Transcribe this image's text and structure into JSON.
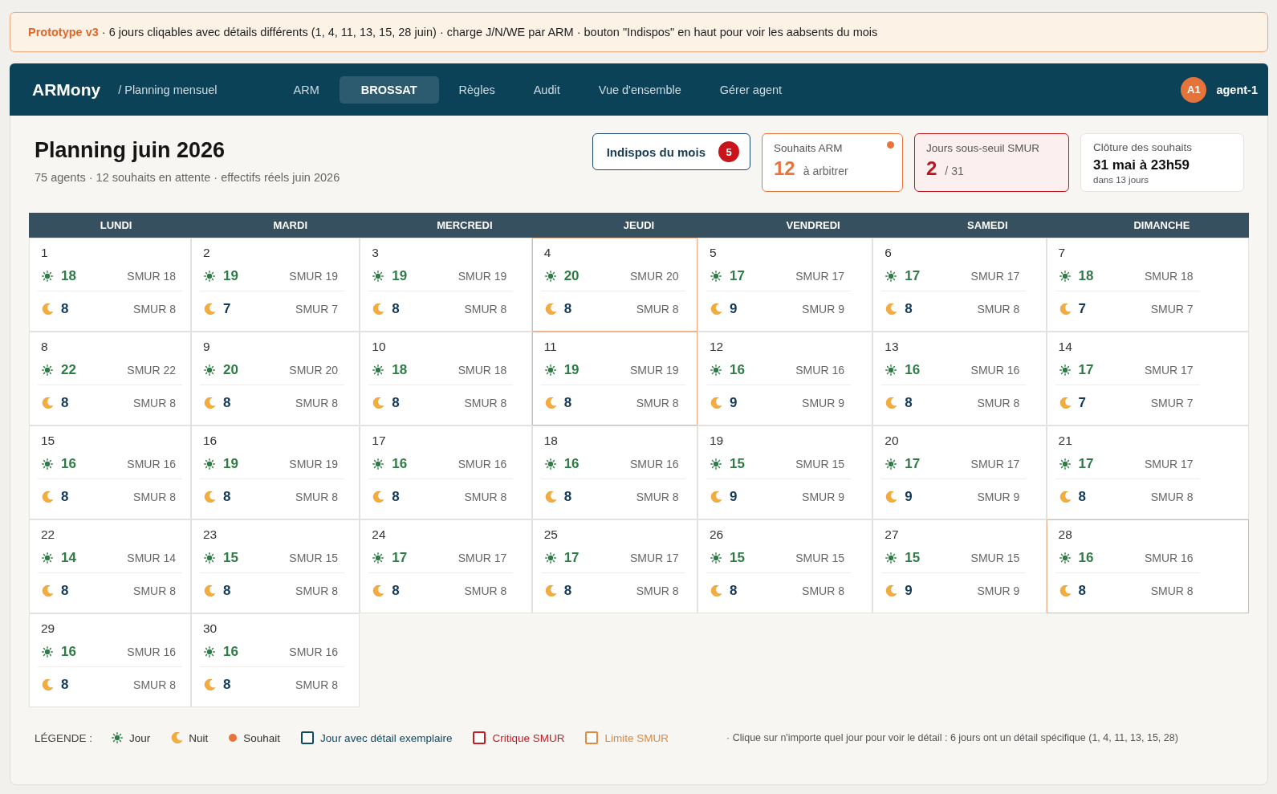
{
  "banner": {
    "text": "**Prototype v3** · 6 jours cliqables avec détails différents (1, 4, 11, 13, 15, 28 juin) · charge J/N/WE par ARM · bouton \"Indispos\" en haut pour voir les aabsents du mois"
  },
  "nav": {
    "brand": "ARMony",
    "breadcrumb": "/ Planning mensuel",
    "tabs": [
      {
        "label": "ARM",
        "selected": false
      },
      {
        "label": "BROSSAT",
        "selected": true
      },
      {
        "label": "Règles",
        "selected": false
      },
      {
        "label": "Audit",
        "selected": false
      },
      {
        "label": "Vue d'ensemble",
        "selected": false
      },
      {
        "label": "Gérer agent",
        "selected": false
      }
    ],
    "user": {
      "initials": "A1",
      "name": "agent-1"
    }
  },
  "header": {
    "title": "Planning juin 2026",
    "subtitle": "75 agents · 12 souhaits en attente · effectifs réels juin 2026"
  },
  "cards": [
    {
      "kind": "button",
      "label": "Indispos du mois",
      "badge": "5"
    },
    {
      "kind": "stat",
      "color": "#e8743c",
      "label": "Souhaits ARM",
      "value": "12",
      "caption": "à arbitrer",
      "dot": true
    },
    {
      "kind": "alert",
      "color": "#c0141c",
      "label": "Jours sous-seuil SMUR",
      "value": "2",
      "caption": "/ 31",
      "dot": false
    },
    {
      "kind": "deadline",
      "label": "Clôture des souhaits",
      "value": "31 mai à 23h59",
      "caption": "dans 13 jours"
    }
  ],
  "calendar": {
    "weekdays": [
      "LUNDI",
      "MARDI",
      "MERCREDI",
      "JEUDI",
      "VENDREDI",
      "SAMEDI",
      "DIMANCHE"
    ],
    "days": [
      {
        "day": "1",
        "limit": false,
        "shifts": [
          {
            "kind": "day",
            "count": "18",
            "smur": "SMUR 18"
          },
          {
            "kind": "night",
            "count": "8",
            "smur": "SMUR 8"
          }
        ]
      },
      {
        "day": "2",
        "limit": false,
        "shifts": [
          {
            "kind": "day",
            "count": "19",
            "smur": "SMUR 19"
          },
          {
            "kind": "night",
            "count": "7",
            "smur": "SMUR 7"
          }
        ]
      },
      {
        "day": "3",
        "limit": false,
        "shifts": [
          {
            "kind": "day",
            "count": "19",
            "smur": "SMUR 19"
          },
          {
            "kind": "night",
            "count": "8",
            "smur": "SMUR 8"
          }
        ]
      },
      {
        "day": "4",
        "limit": true,
        "shifts": [
          {
            "kind": "day",
            "count": "20",
            "smur": "SMUR 20"
          },
          {
            "kind": "night",
            "count": "8",
            "smur": "SMUR 8"
          }
        ]
      },
      {
        "day": "5",
        "limit": false,
        "shifts": [
          {
            "kind": "day",
            "count": "17",
            "smur": "SMUR 17"
          },
          {
            "kind": "night",
            "count": "9",
            "smur": "SMUR 9"
          }
        ]
      },
      {
        "day": "6",
        "limit": false,
        "shifts": [
          {
            "kind": "day",
            "count": "17",
            "smur": "SMUR 17"
          },
          {
            "kind": "night",
            "count": "8",
            "smur": "SMUR 8"
          }
        ]
      },
      {
        "day": "7",
        "limit": false,
        "shifts": [
          {
            "kind": "day",
            "count": "18",
            "smur": "SMUR 18"
          },
          {
            "kind": "night",
            "count": "7",
            "smur": "SMUR 7"
          }
        ]
      },
      {
        "day": "8",
        "limit": false,
        "shifts": [
          {
            "kind": "day",
            "count": "22",
            "smur": "SMUR 22"
          },
          {
            "kind": "night",
            "count": "8",
            "smur": "SMUR 8"
          }
        ]
      },
      {
        "day": "9",
        "limit": false,
        "shifts": [
          {
            "kind": "day",
            "count": "20",
            "smur": "SMUR 20"
          },
          {
            "kind": "night",
            "count": "8",
            "smur": "SMUR 8"
          }
        ]
      },
      {
        "day": "10",
        "limit": false,
        "shifts": [
          {
            "kind": "day",
            "count": "18",
            "smur": "SMUR 18"
          },
          {
            "kind": "night",
            "count": "8",
            "smur": "SMUR 8"
          }
        ]
      },
      {
        "day": "11",
        "limit": true,
        "shifts": [
          {
            "kind": "day",
            "count": "19",
            "smur": "SMUR 19"
          },
          {
            "kind": "night",
            "count": "8",
            "smur": "SMUR 8"
          }
        ]
      },
      {
        "day": "12",
        "limit": false,
        "shifts": [
          {
            "kind": "day",
            "count": "16",
            "smur": "SMUR 16"
          },
          {
            "kind": "night",
            "count": "9",
            "smur": "SMUR 9"
          }
        ]
      },
      {
        "day": "13",
        "limit": false,
        "shifts": [
          {
            "kind": "day",
            "count": "16",
            "smur": "SMUR 16"
          },
          {
            "kind": "night",
            "count": "8",
            "smur": "SMUR 8"
          }
        ]
      },
      {
        "day": "14",
        "limit": false,
        "shifts": [
          {
            "kind": "day",
            "count": "17",
            "smur": "SMUR 17"
          },
          {
            "kind": "night",
            "count": "7",
            "smur": "SMUR 7"
          }
        ]
      },
      {
        "day": "15",
        "limit": false,
        "shifts": [
          {
            "kind": "day",
            "count": "16",
            "smur": "SMUR 16"
          },
          {
            "kind": "night",
            "count": "8",
            "smur": "SMUR 8"
          }
        ]
      },
      {
        "day": "16",
        "limit": false,
        "shifts": [
          {
            "kind": "day",
            "count": "19",
            "smur": "SMUR 19"
          },
          {
            "kind": "night",
            "count": "8",
            "smur": "SMUR 8"
          }
        ]
      },
      {
        "day": "17",
        "limit": false,
        "shifts": [
          {
            "kind": "day",
            "count": "16",
            "smur": "SMUR 16"
          },
          {
            "kind": "night",
            "count": "8",
            "smur": "SMUR 8"
          }
        ]
      },
      {
        "day": "18",
        "limit": false,
        "shifts": [
          {
            "kind": "day",
            "count": "16",
            "smur": "SMUR 16"
          },
          {
            "kind": "night",
            "count": "8",
            "smur": "SMUR 8"
          }
        ]
      },
      {
        "day": "19",
        "limit": false,
        "shifts": [
          {
            "kind": "day",
            "count": "15",
            "smur": "SMUR 15"
          },
          {
            "kind": "night",
            "count": "9",
            "smur": "SMUR 9"
          }
        ]
      },
      {
        "day": "20",
        "limit": false,
        "shifts": [
          {
            "kind": "day",
            "count": "17",
            "smur": "SMUR 17"
          },
          {
            "kind": "night",
            "count": "9",
            "smur": "SMUR 9"
          }
        ]
      },
      {
        "day": "21",
        "limit": false,
        "shifts": [
          {
            "kind": "day",
            "count": "17",
            "smur": "SMUR 17"
          },
          {
            "kind": "night",
            "count": "8",
            "smur": "SMUR 8"
          }
        ]
      },
      {
        "day": "22",
        "limit": false,
        "shifts": [
          {
            "kind": "day",
            "count": "14",
            "smur": "SMUR 14"
          },
          {
            "kind": "night",
            "count": "8",
            "smur": "SMUR 8"
          }
        ]
      },
      {
        "day": "23",
        "limit": false,
        "shifts": [
          {
            "kind": "day",
            "count": "15",
            "smur": "SMUR 15"
          },
          {
            "kind": "night",
            "count": "8",
            "smur": "SMUR 8"
          }
        ]
      },
      {
        "day": "24",
        "limit": false,
        "shifts": [
          {
            "kind": "day",
            "count": "17",
            "smur": "SMUR 17"
          },
          {
            "kind": "night",
            "count": "8",
            "smur": "SMUR 8"
          }
        ]
      },
      {
        "day": "25",
        "limit": false,
        "shifts": [
          {
            "kind": "day",
            "count": "17",
            "smur": "SMUR 17"
          },
          {
            "kind": "night",
            "count": "8",
            "smur": "SMUR 8"
          }
        ]
      },
      {
        "day": "26",
        "limit": false,
        "shifts": [
          {
            "kind": "day",
            "count": "15",
            "smur": "SMUR 15"
          },
          {
            "kind": "night",
            "count": "8",
            "smur": "SMUR 8"
          }
        ]
      },
      {
        "day": "27",
        "limit": false,
        "shifts": [
          {
            "kind": "day",
            "count": "15",
            "smur": "SMUR 15"
          },
          {
            "kind": "night",
            "count": "9",
            "smur": "SMUR 9"
          }
        ]
      },
      {
        "day": "28",
        "limit": true,
        "shifts": [
          {
            "kind": "day",
            "count": "16",
            "smur": "SMUR 16"
          },
          {
            "kind": "night",
            "count": "8",
            "smur": "SMUR 8"
          }
        ]
      },
      {
        "day": "29",
        "limit": false,
        "shifts": [
          {
            "kind": "day",
            "count": "16",
            "smur": "SMUR 16"
          },
          {
            "kind": "night",
            "count": "8",
            "smur": "SMUR 8"
          }
        ]
      },
      {
        "day": "30",
        "limit": false,
        "shifts": [
          {
            "kind": "day",
            "count": "16",
            "smur": "SMUR 16"
          },
          {
            "kind": "night",
            "count": "8",
            "smur": "SMUR 8"
          }
        ]
      }
    ]
  },
  "legend": {
    "title": "LÉGENDE :",
    "items": [
      {
        "kind": "sun",
        "label": "Jour"
      },
      {
        "kind": "moon",
        "label": "Nuit"
      },
      {
        "kind": "dot",
        "label": "Souhait",
        "color": "#e8743c"
      },
      {
        "kind": "square",
        "label": "Jour avec détail exemplaire",
        "color": "#0f4a63"
      },
      {
        "kind": "square",
        "label": "Critique SMUR",
        "color": "#c41e24"
      },
      {
        "kind": "square",
        "label": "Limite SMUR",
        "color": "#e0893f"
      }
    ],
    "note": "· Clique sur n'importe quel jour pour voir le détail : 6 jours ont un détail spécifique (1, 4, 11, 13, 15, 28)"
  }
}
